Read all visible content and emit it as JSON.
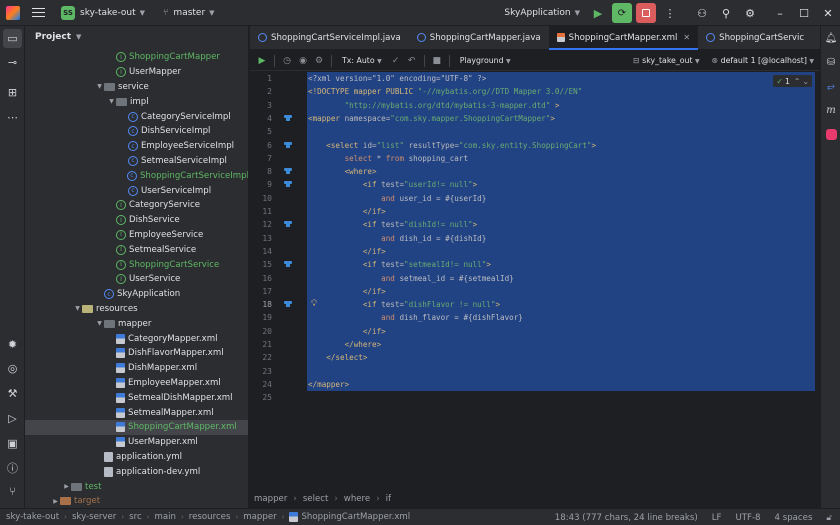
{
  "titlebar": {
    "project_badge": "SS",
    "project_name": "sky-take-out",
    "branch": "master",
    "run_config": "SkyApplication",
    "icons": [
      "hamburger-icon",
      "branch-icon",
      "run-icon",
      "debug-icon",
      "stop-icon",
      "more-icon",
      "add-user-icon",
      "search-icon",
      "settings-icon",
      "minimize-icon",
      "maximize-icon",
      "close-icon"
    ]
  },
  "project": {
    "title": "Project",
    "items": [
      {
        "label": "ShoppingCartMapper",
        "kind": "iface",
        "indent": 1,
        "color": "green"
      },
      {
        "label": "UserMapper",
        "kind": "iface",
        "indent": 1
      },
      {
        "label": "service",
        "kind": "folder",
        "indent": 0,
        "arrow": "open"
      },
      {
        "label": "impl",
        "kind": "folder",
        "indent": 1,
        "arrow": "open"
      },
      {
        "label": "CategoryServiceImpl",
        "kind": "class",
        "indent": 2
      },
      {
        "label": "DishServiceImpl",
        "kind": "class",
        "indent": 2
      },
      {
        "label": "EmployeeServiceImpl",
        "kind": "class",
        "indent": 2
      },
      {
        "label": "SetmealServiceImpl",
        "kind": "class",
        "indent": 2
      },
      {
        "label": "ShoppingCartServiceImpl",
        "kind": "class",
        "indent": 2,
        "color": "green"
      },
      {
        "label": "UserServiceImpl",
        "kind": "class",
        "indent": 2
      },
      {
        "label": "CategoryService",
        "kind": "iface",
        "indent": 1
      },
      {
        "label": "DishService",
        "kind": "iface",
        "indent": 1
      },
      {
        "label": "EmployeeService",
        "kind": "iface",
        "indent": 1
      },
      {
        "label": "SetmealService",
        "kind": "iface",
        "indent": 1
      },
      {
        "label": "ShoppingCartService",
        "kind": "iface",
        "indent": 1,
        "color": "green"
      },
      {
        "label": "UserService",
        "kind": "iface",
        "indent": 1
      },
      {
        "label": "SkyApplication",
        "kind": "app",
        "indent": 0
      },
      {
        "label": "resources",
        "kind": "resfolder",
        "indent": -1,
        "arrow": "open"
      },
      {
        "label": "mapper",
        "kind": "folder",
        "indent": 0,
        "arrow": "open"
      },
      {
        "label": "CategoryMapper.xml",
        "kind": "xml",
        "indent": 1
      },
      {
        "label": "DishFlavorMapper.xml",
        "kind": "xml",
        "indent": 1
      },
      {
        "label": "DishMapper.xml",
        "kind": "xml",
        "indent": 1
      },
      {
        "label": "EmployeeMapper.xml",
        "kind": "xml",
        "indent": 1
      },
      {
        "label": "SetmealDishMapper.xml",
        "kind": "xml",
        "indent": 1
      },
      {
        "label": "SetmealMapper.xml",
        "kind": "xml",
        "indent": 1
      },
      {
        "label": "ShoppingCartMapper.xml",
        "kind": "xml",
        "indent": 1,
        "color": "green",
        "selected": true
      },
      {
        "label": "UserMapper.xml",
        "kind": "xml",
        "indent": 1
      },
      {
        "label": "application.yml",
        "kind": "yml",
        "indent": 0
      },
      {
        "label": "application-dev.yml",
        "kind": "yml",
        "indent": 0
      },
      {
        "label": "test",
        "kind": "folder",
        "indent": -2,
        "arrow": "closed",
        "color": "green"
      },
      {
        "label": "target",
        "kind": "target",
        "indent": -3,
        "arrow": "closed"
      }
    ]
  },
  "tabs": [
    {
      "label": "ShoppingCartServiceImpl.java",
      "type": "java",
      "active": false
    },
    {
      "label": "ShoppingCartMapper.java",
      "type": "java",
      "active": false
    },
    {
      "label": "ShoppingCartMapper.xml",
      "type": "xml",
      "active": true
    },
    {
      "label": "ShoppingCartServic",
      "type": "java",
      "active": false
    }
  ],
  "editor_toolbar": {
    "tx": "Tx: Auto",
    "playground": "Playground",
    "schema": "sky_take_out",
    "datasource": "default 1 [@localhost]"
  },
  "inspection": "1",
  "code": [
    [
      [
        "decl",
        "<?xml version=\"1.0\" encoding=\"UTF-8\" ?>"
      ]
    ],
    [
      [
        "tag",
        "<!DOCTYPE mapper PUBLIC "
      ],
      [
        "val",
        "\"-//mybatis.org//DTD Mapper 3.0//EN\""
      ]
    ],
    [
      [
        "val",
        "        \"http://mybatis.org/dtd/mybatis-3-mapper.dtd\""
      ],
      [
        "tag",
        " >"
      ]
    ],
    [
      [
        "tag",
        "<mapper "
      ],
      [
        "attr",
        "namespace="
      ],
      [
        "val",
        "\"com.sky.mapper.ShoppingCartMapper\""
      ],
      [
        "tag",
        ">"
      ]
    ],
    [],
    [
      [
        "tag",
        "    <select "
      ],
      [
        "attr",
        "id="
      ],
      [
        "val",
        "\"list\" "
      ],
      [
        "attr",
        "resultType="
      ],
      [
        "val",
        "\"com.sky.entity.ShoppingCart\""
      ],
      [
        "tag",
        ">"
      ]
    ],
    [
      [
        "sql",
        "        select "
      ],
      [
        "plain",
        "* "
      ],
      [
        "sql",
        "from "
      ],
      [
        "plain",
        "shopping_cart"
      ]
    ],
    [
      [
        "tag",
        "        <where>"
      ]
    ],
    [
      [
        "tag",
        "            <if "
      ],
      [
        "attr",
        "test="
      ],
      [
        "val",
        "\"userId!= null\""
      ],
      [
        "tag",
        ">"
      ]
    ],
    [
      [
        "sql",
        "                and "
      ],
      [
        "plain",
        "user_id = #{userId}"
      ]
    ],
    [
      [
        "tag",
        "            </if>"
      ]
    ],
    [
      [
        "tag",
        "            <if "
      ],
      [
        "attr",
        "test="
      ],
      [
        "val",
        "\"dishId!= null\""
      ],
      [
        "tag",
        ">"
      ]
    ],
    [
      [
        "sql",
        "                and "
      ],
      [
        "plain",
        "dish_id = #{dishId}"
      ]
    ],
    [
      [
        "tag",
        "            </if>"
      ]
    ],
    [
      [
        "tag",
        "            <if "
      ],
      [
        "attr",
        "test="
      ],
      [
        "val",
        "\"setmealId!= null\""
      ],
      [
        "tag",
        ">"
      ]
    ],
    [
      [
        "sql",
        "                and "
      ],
      [
        "plain",
        "setmeal_id = #{setmealId}"
      ]
    ],
    [
      [
        "tag",
        "            </if>"
      ]
    ],
    [
      [
        "tag",
        "            <if "
      ],
      [
        "attr",
        "test="
      ],
      [
        "val",
        "\"dishFlavor != null\""
      ],
      [
        "tag",
        ">"
      ]
    ],
    [
      [
        "sql",
        "                and "
      ],
      [
        "plain",
        "dish_flavor = #{dishFlavor}"
      ]
    ],
    [
      [
        "tag",
        "            </if>"
      ]
    ],
    [
      [
        "tag",
        "        </where>"
      ]
    ],
    [
      [
        "tag",
        "    </select>"
      ]
    ],
    [],
    [
      [
        "tag",
        "</mapper>"
      ]
    ],
    []
  ],
  "gutter_marks": [
    4,
    6,
    8,
    9,
    12,
    15,
    18
  ],
  "current_line": 18,
  "breadcrumb": [
    "mapper",
    "select",
    "where",
    "if"
  ],
  "statusbar": {
    "path": [
      "sky-take-out",
      "sky-server",
      "src",
      "main",
      "resources",
      "mapper",
      "ShoppingCartMapper.xml"
    ],
    "position": "18:43 (777 chars, 24 line breaks)",
    "line_sep": "LF",
    "encoding": "UTF-8",
    "indent": "4 spaces"
  }
}
